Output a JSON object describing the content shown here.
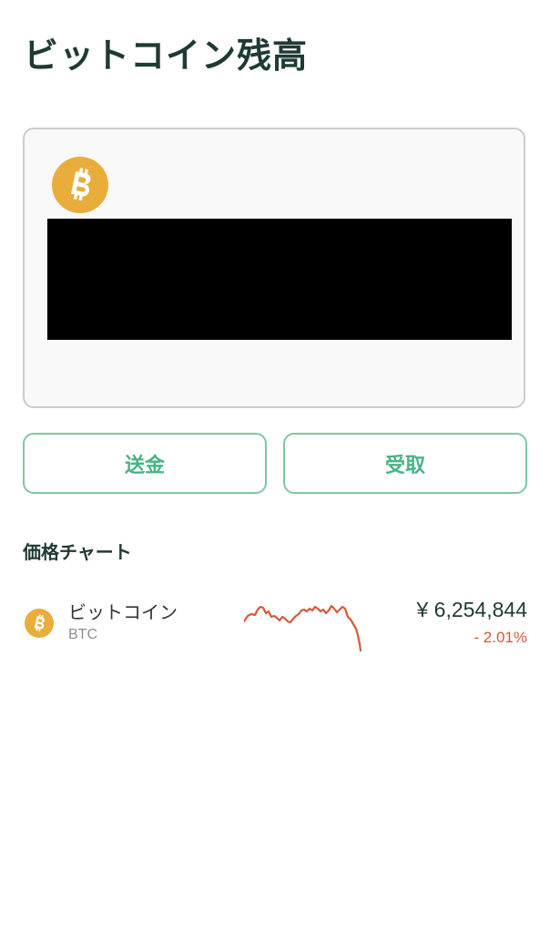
{
  "header": {
    "title": "ビットコイン残高"
  },
  "balance_card": {
    "coin_icon": "bitcoin-icon",
    "coin_color": "#e9ad3c",
    "balance_redacted": true
  },
  "actions": {
    "send_label": "送金",
    "receive_label": "受取",
    "accent_color": "#47b386"
  },
  "price_chart": {
    "section_title": "価格チャート",
    "items": [
      {
        "icon": "bitcoin-icon",
        "name": "ビットコイン",
        "ticker": "BTC",
        "price": "¥ 6,254,844",
        "change": "- 2.01%",
        "change_color": "#d4583a"
      }
    ]
  }
}
